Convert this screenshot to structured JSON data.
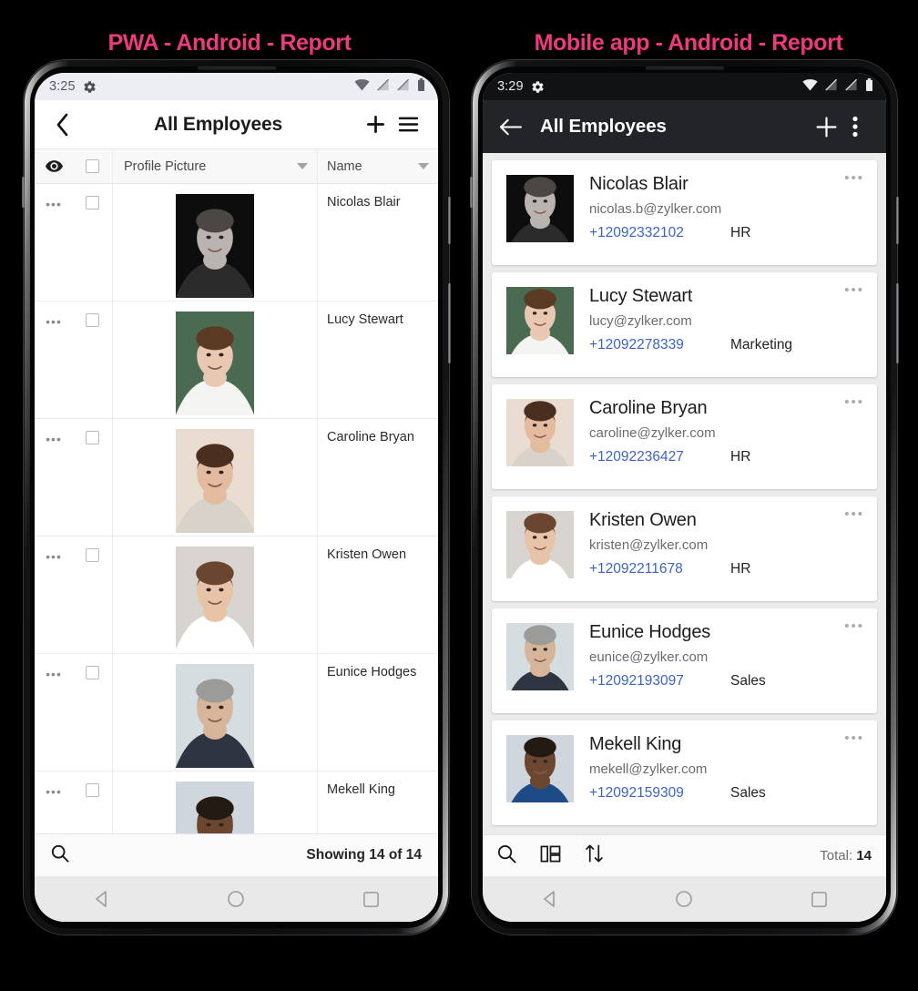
{
  "captions": {
    "left": "PWA - Android - Report",
    "right": "Mobile app - Android - Report",
    "color": "#ec3b7e"
  },
  "pwa": {
    "status": {
      "time": "3:25",
      "icons": [
        "gear-icon",
        "wifi-icon",
        "signal-off-icon",
        "signal-off-icon",
        "battery-icon"
      ]
    },
    "header": {
      "title": "All Employees",
      "back": "back-chevron-icon",
      "add": "plus-icon",
      "menu": "hamburger-menu-icon"
    },
    "table": {
      "columns": [
        "Profile Picture",
        "Name"
      ],
      "eye_icon": "eye-icon",
      "rows": [
        {
          "name": "Nicolas Blair",
          "photo": "p1"
        },
        {
          "name": "Lucy Stewart",
          "photo": "p2"
        },
        {
          "name": "Caroline Bryan",
          "photo": "p3"
        },
        {
          "name": "Kristen Owen",
          "photo": "p4"
        },
        {
          "name": "Eunice Hodges",
          "photo": "p5"
        },
        {
          "name": "Mekell King",
          "photo": "p6"
        }
      ]
    },
    "footer": {
      "search": "search-icon",
      "showing": "Showing 14 of 14"
    }
  },
  "native": {
    "status": {
      "time": "3:29",
      "icons": [
        "gear-icon",
        "wifi-icon",
        "signal-off-icon",
        "signal-off-icon",
        "battery-icon"
      ]
    },
    "header": {
      "title": "All Employees",
      "back": "back-arrow-icon",
      "add": "plus-icon",
      "menu": "kebab-menu-icon"
    },
    "cards": [
      {
        "name": "Nicolas Blair",
        "email": "nicolas.b@zylker.com",
        "phone": "+12092332102",
        "dept": "HR",
        "photo": "p1"
      },
      {
        "name": "Lucy Stewart",
        "email": "lucy@zylker.com",
        "phone": "+12092278339",
        "dept": "Marketing",
        "photo": "p2"
      },
      {
        "name": "Caroline Bryan",
        "email": "caroline@zylker.com",
        "phone": "+12092236427",
        "dept": "HR",
        "photo": "p3"
      },
      {
        "name": "Kristen Owen",
        "email": "kristen@zylker.com",
        "phone": "+12092211678",
        "dept": "HR",
        "photo": "p4"
      },
      {
        "name": "Eunice Hodges",
        "email": "eunice@zylker.com",
        "phone": "+12092193097",
        "dept": "Sales",
        "photo": "p5"
      },
      {
        "name": "Mekell King",
        "email": "mekell@zylker.com",
        "phone": "+12092159309",
        "dept": "Sales",
        "photo": "p6"
      }
    ],
    "footer": {
      "search": "search-icon",
      "layout": "layout-view-icon",
      "sort": "sort-arrows-icon",
      "total_label": "Total:",
      "total_value": "14"
    }
  },
  "navbar": {
    "back": "nav-back-icon",
    "home": "nav-home-icon",
    "recents": "nav-recents-icon"
  },
  "dots_glyph": "•••"
}
